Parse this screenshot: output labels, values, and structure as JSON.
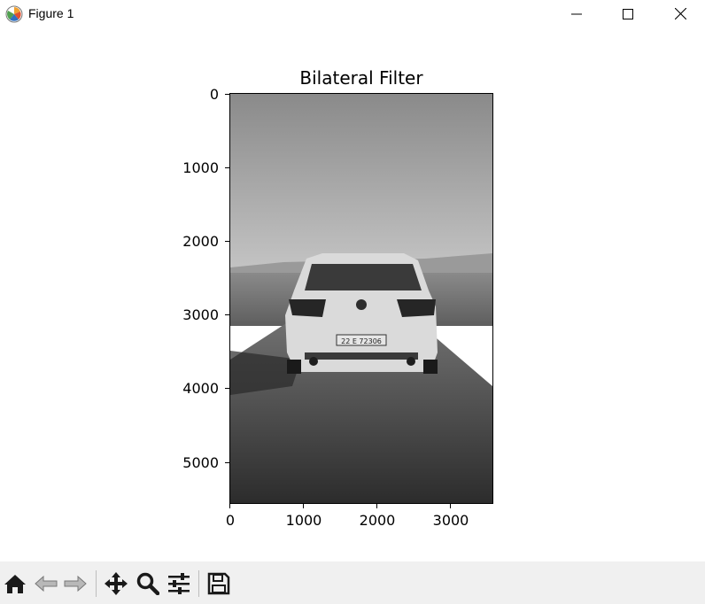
{
  "window": {
    "title": "Figure 1",
    "icons": {
      "app": "matplotlib-logo-icon",
      "minimize": "minimize-icon",
      "maximize": "maximize-icon",
      "close": "close-icon"
    }
  },
  "figure": {
    "title": "Bilateral Filter",
    "image_description_mode": "grayscale",
    "y_ticks": [
      "0",
      "1000",
      "2000",
      "3000",
      "4000",
      "5000"
    ],
    "x_ticks": [
      "0",
      "1000",
      "2000",
      "3000"
    ],
    "y_range": [
      0,
      5568
    ],
    "x_range": [
      0,
      3574
    ],
    "license_plate_text": "22 E 72306"
  },
  "toolbar": {
    "buttons": [
      {
        "name": "home-button",
        "icon": "home-icon"
      },
      {
        "name": "back-button",
        "icon": "back-arrow-icon"
      },
      {
        "name": "forward-button",
        "icon": "forward-arrow-icon"
      },
      {
        "name": "pan-button",
        "icon": "move-icon"
      },
      {
        "name": "zoom-button",
        "icon": "magnifier-icon"
      },
      {
        "name": "configure-subplots-button",
        "icon": "sliders-icon"
      },
      {
        "name": "save-button",
        "icon": "floppy-disk-icon"
      }
    ]
  }
}
